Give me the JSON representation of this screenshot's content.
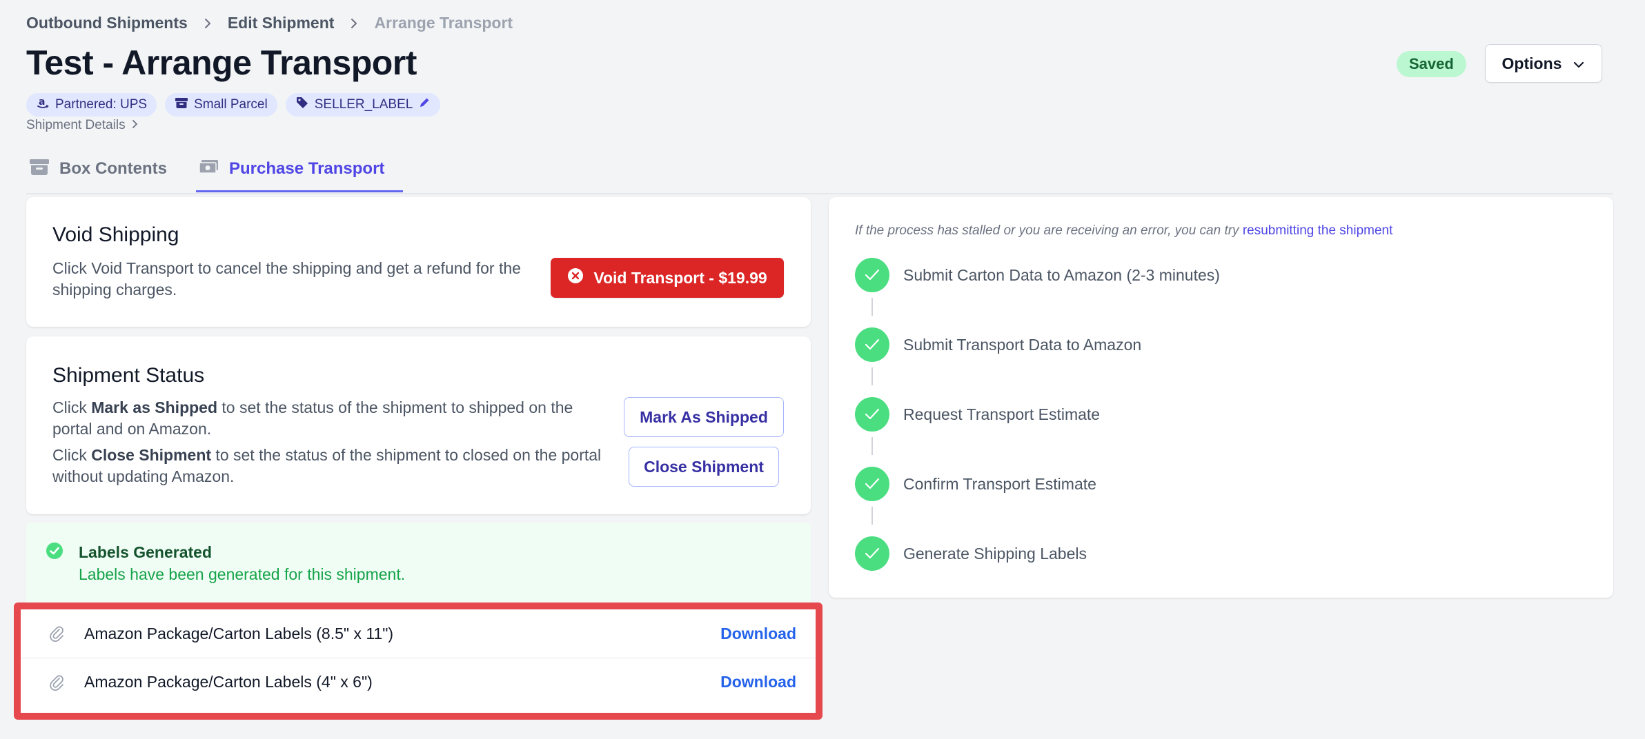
{
  "breadcrumb": {
    "items": [
      "Outbound Shipments",
      "Edit Shipment"
    ],
    "current": "Arrange Transport"
  },
  "page": {
    "title": "Test - Arrange Transport",
    "saved_label": "Saved",
    "options_label": "Options"
  },
  "badges": {
    "carrier": "Partnered: UPS",
    "parcel": "Small Parcel",
    "label_type": "SELLER_LABEL"
  },
  "details_link": "Shipment Details",
  "tabs": {
    "box_contents": "Box Contents",
    "purchase_transport": "Purchase Transport",
    "active": "Purchase Transport"
  },
  "void": {
    "title": "Void Shipping",
    "description": "Click Void Transport to cancel the shipping and get a refund for the shipping charges.",
    "button": "Void Transport - $19.99"
  },
  "status": {
    "title": "Shipment Status",
    "line1_bold": "Mark as Shipped",
    "line1_pre": "Click ",
    "line1_post": " to set the status of the shipment to shipped on the portal and on Amazon.",
    "line2_bold": "Close Shipment",
    "line2_pre": "Click ",
    "line2_post": " to set the status of the shipment to closed on the portal without updating Amazon.",
    "mark_shipped_button": "Mark As Shipped",
    "close_button": "Close Shipment"
  },
  "alert": {
    "title": "Labels Generated",
    "text": "Labels have been generated for this shipment."
  },
  "files": [
    {
      "name": "Amazon Package/Carton Labels (8.5\" x 11\")",
      "action": "Download"
    },
    {
      "name": "Amazon Package/Carton Labels (4\" x 6\")",
      "action": "Download"
    }
  ],
  "steps": {
    "note": "If the process has stalled or you are receiving an error, you can try ",
    "note_link": "resubmitting the shipment",
    "items": [
      {
        "label": "Submit Carton Data to Amazon (2-3 minutes)",
        "status": "complete"
      },
      {
        "label": "Submit Transport Data to Amazon",
        "status": "complete"
      },
      {
        "label": "Request Transport Estimate",
        "status": "complete"
      },
      {
        "label": "Confirm Transport Estimate",
        "status": "complete"
      },
      {
        "label": "Generate Shipping Labels",
        "status": "complete"
      }
    ]
  },
  "colors": {
    "accent": "#4f46e5",
    "danger": "#dc2626",
    "success": "#4ade80",
    "highlight_border": "#e5484d"
  }
}
